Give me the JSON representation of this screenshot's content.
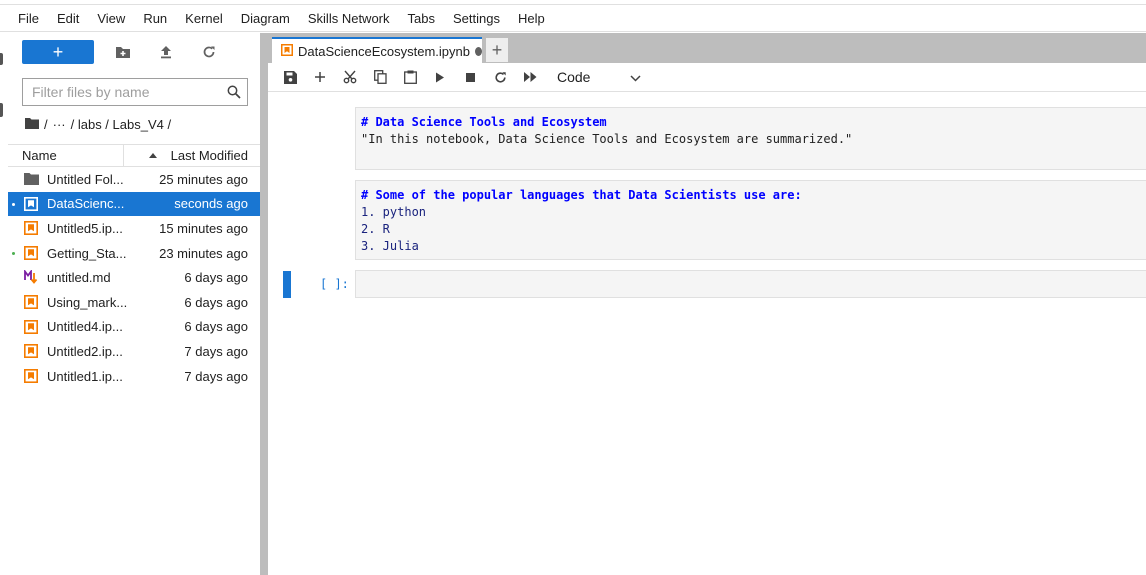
{
  "menubar": {
    "items": [
      "File",
      "Edit",
      "View",
      "Run",
      "Kernel",
      "Diagram",
      "Skills Network",
      "Tabs",
      "Settings",
      "Help"
    ]
  },
  "filebrowser": {
    "new_label": "+",
    "filter_placeholder": "Filter files by name",
    "breadcrumbs": [
      "/",
      "···",
      "/ labs / Labs_V4 /"
    ],
    "columns": {
      "name": "Name",
      "modified": "Last Modified"
    },
    "files": [
      {
        "name": "Untitled Fol...",
        "modified": "25 minutes ago",
        "type": "folder",
        "selected": false,
        "running": false
      },
      {
        "name": "DataScienc...",
        "modified": "seconds ago",
        "type": "notebook",
        "selected": true,
        "running": true
      },
      {
        "name": "Untitled5.ip...",
        "modified": "15 minutes ago",
        "type": "notebook",
        "selected": false,
        "running": false
      },
      {
        "name": "Getting_Sta...",
        "modified": "23 minutes ago",
        "type": "notebook",
        "selected": false,
        "running": true
      },
      {
        "name": "untitled.md",
        "modified": "6 days ago",
        "type": "markdown",
        "selected": false,
        "running": false
      },
      {
        "name": "Using_mark...",
        "modified": "6 days ago",
        "type": "notebook",
        "selected": false,
        "running": false
      },
      {
        "name": "Untitled4.ip...",
        "modified": "6 days ago",
        "type": "notebook",
        "selected": false,
        "running": false
      },
      {
        "name": "Untitled2.ip...",
        "modified": "7 days ago",
        "type": "notebook",
        "selected": false,
        "running": false
      },
      {
        "name": "Untitled1.ip...",
        "modified": "7 days ago",
        "type": "notebook",
        "selected": false,
        "running": false
      }
    ]
  },
  "tabs": {
    "active": "DataScienceEcosystem.ipynb",
    "add_label": "+"
  },
  "notebook_toolbar": {
    "cell_type": "Code"
  },
  "cells": {
    "cell1": {
      "line1": "# Data Science Tools and Ecosystem",
      "line2": "\"In this notebook, Data Science Tools and Ecosystem are summarized.\""
    },
    "cell2": {
      "line1": "# Some of the popular languages that Data Scientists use are:",
      "line2": "1. python",
      "line3": "2. R",
      "line4": "3. Julia"
    },
    "cell3": {
      "prompt": "[ ]:"
    }
  },
  "colors": {
    "accent": "#1976d2",
    "notebook_icon": "#f57c00",
    "markdown_icon": "#7b1fa2",
    "running_dot": "#4caf50",
    "markdown_header": "#0000ff"
  }
}
